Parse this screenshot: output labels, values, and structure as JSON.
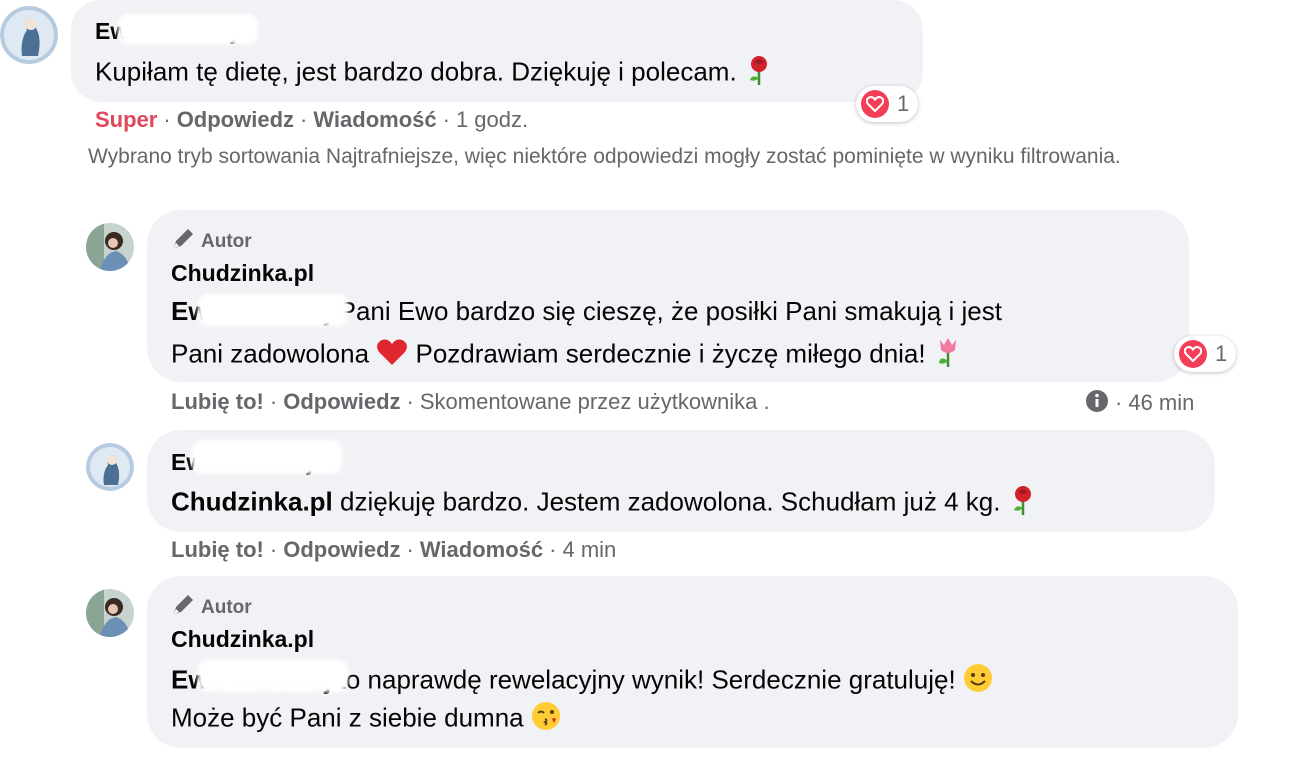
{
  "comments": [
    {
      "author": "Ewa Ozdchaj",
      "text": "Kupiłam tę dietę, jest bardzo dobra. Dziękuję i polecam.",
      "reaction_count": "1",
      "actions": {
        "reaction": "Super",
        "reply": "Odpowiedz",
        "message": "Wiadomość",
        "time": "1 godz."
      }
    }
  ],
  "sort_note": "Wybrano tryb sortowania Najtrafniejsze, więc niektóre odpowiedzi mogły zostać pominięte w wyniku filtrowania.",
  "replies": [
    {
      "badge": "Autor",
      "author": "Chudzinka.pl",
      "mention": "Ewa Ozdchaj",
      "text1": " Pani Ewo bardzo się cieszę, że posiłki Pani smakują i jest",
      "text2": "Pani zadowolona",
      "text3": " Pozdrawiam serdecznie i życzę miłego dnia!",
      "reaction_count": "1",
      "actions": {
        "like": "Lubię to!",
        "reply": "Odpowiedz",
        "commented_by": "Skomentowane przez użytkownika",
        "time": "46 min"
      }
    },
    {
      "author": "Ewa Ozdchaj",
      "mention": "Chudzinka.pl",
      "text": " dziękuję bardzo. Jestem zadowolona. Schudłam już 4 kg.",
      "actions": {
        "like": "Lubię to!",
        "reply": "Odpowiedz",
        "message": "Wiadomość",
        "time": "4 min"
      }
    },
    {
      "badge": "Autor",
      "author": "Chudzinka.pl",
      "mention": "Ewa Ozdchaj",
      "text1": " to naprawdę rewelacyjny wynik! Serdecznie gratuluję!",
      "text2": "Może być Pani z siebie dumna"
    }
  ],
  "colors": {
    "bubble": "#f0f2f5",
    "super": "#e0475a",
    "meta": "#65676b",
    "heart": "#f33e58"
  }
}
